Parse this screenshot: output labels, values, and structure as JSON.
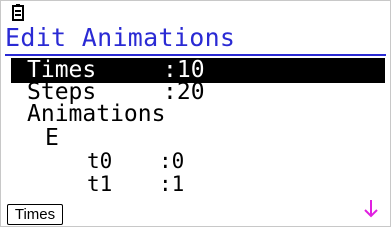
{
  "screen": {
    "title": "Edit Animations",
    "settings": [
      {
        "label": "Times",
        "value": ":10",
        "selected": true
      },
      {
        "label": "Steps",
        "value": ":20",
        "selected": false
      }
    ],
    "animations_label": "Animations",
    "variable": "E",
    "variable_rows": [
      {
        "name": "t0",
        "value": ":0"
      },
      {
        "name": "t1",
        "value": ":1"
      }
    ],
    "scroll_indicator": "down-arrow-icon",
    "function_key_f1": "Times"
  },
  "colors": {
    "title": "#2a2ad4",
    "selection_bg": "#000000",
    "scroll_arrow": "#e020e0"
  }
}
